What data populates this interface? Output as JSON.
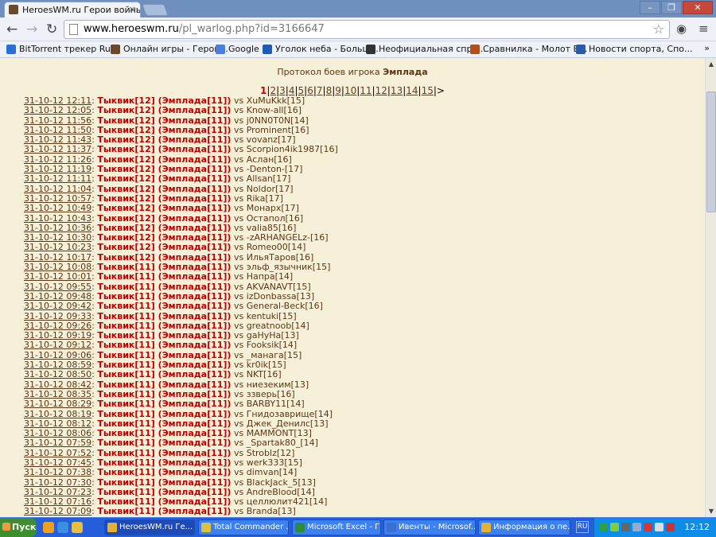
{
  "browser": {
    "tab_title": "HeroesWM.ru Герои войны и",
    "tab_close": "×",
    "window_buttons": [
      "–",
      "❐",
      "✕"
    ],
    "url_host": "www.heroeswm.ru",
    "url_path": "/pl_warlog.php?id=3166647",
    "bookmarks": [
      {
        "label": "BitTorrent трекер Ru...",
        "icon_color": "#2a6fd6"
      },
      {
        "label": "Онлайн игры - Герои...",
        "icon_color": "#6a4a2a"
      },
      {
        "label": "Google",
        "icon_color": "#4a7fe0"
      },
      {
        "label": "Уголок неба - Больш...",
        "icon_color": "#1a5fb4"
      },
      {
        "label": "Неофициальная спра...",
        "icon_color": "#333333"
      },
      {
        "label": "Сравнилка - Молот В...",
        "icon_color": "#b0501a"
      },
      {
        "label": "Новости спорта, Спо...",
        "icon_color": "#2b5aa8"
      }
    ],
    "bookmarks_more": "»"
  },
  "page": {
    "heading_prefix": "Протокол боев игрока",
    "player_name": "Эмплада",
    "pager": {
      "current": "1",
      "pages": [
        "2",
        "3",
        "4",
        "5",
        "6",
        "7",
        "8",
        "9",
        "10",
        "11",
        "12",
        "13",
        "14",
        "15"
      ],
      "next": ">"
    },
    "log": [
      {
        "date": "31-10-12 12:11",
        "team": "Тыквик[12] (Эмплада[11])",
        "opp": "XuMuKkk[15]"
      },
      {
        "date": "31-10-12 12:05",
        "team": "Тыквик[12] (Эмплада[11])",
        "opp": "Know-all[16]"
      },
      {
        "date": "31-10-12 11:56",
        "team": "Тыквик[12] (Эмплада[11])",
        "opp": "j0NN0T0N[14]"
      },
      {
        "date": "31-10-12 11:50",
        "team": "Тыквик[12] (Эмплада[11])",
        "opp": "Prominent[16]"
      },
      {
        "date": "31-10-12 11:43",
        "team": "Тыквик[12] (Эмплада[11])",
        "opp": "vovanz[17]"
      },
      {
        "date": "31-10-12 11:37",
        "team": "Тыквик[12] (Эмплада[11])",
        "opp": "Scorpion4ik1987[16]"
      },
      {
        "date": "31-10-12 11:26",
        "team": "Тыквик[12] (Эмплада[11])",
        "opp": "Аслан[16]"
      },
      {
        "date": "31-10-12 11:19",
        "team": "Тыквик[12] (Эмплада[11])",
        "opp": "-Denton-[17]"
      },
      {
        "date": "31-10-12 11:11",
        "team": "Тыквик[12] (Эмплада[11])",
        "opp": "Allsan[17]"
      },
      {
        "date": "31-10-12 11:04",
        "team": "Тыквик[12] (Эмплада[11])",
        "opp": "Noldor[17]"
      },
      {
        "date": "31-10-12 10:57",
        "team": "Тыквик[12] (Эмплада[11])",
        "opp": "Rika[17]"
      },
      {
        "date": "31-10-12 10:49",
        "team": "Тыквик[12] (Эмплада[11])",
        "opp": "Монарх[17]"
      },
      {
        "date": "31-10-12 10:43",
        "team": "Тыквик[12] (Эмплада[11])",
        "opp": "Остапол[16]"
      },
      {
        "date": "31-10-12 10:36",
        "team": "Тыквик[12] (Эмплада[11])",
        "opp": "valia85[16]"
      },
      {
        "date": "31-10-12 10:30",
        "team": "Тыквик[12] (Эмплада[11])",
        "opp": "-zARHANGELz-[16]"
      },
      {
        "date": "31-10-12 10:23",
        "team": "Тыквик[12] (Эмплада[11])",
        "opp": "Romeo00[14]"
      },
      {
        "date": "31-10-12 10:17",
        "team": "Тыквик[12] (Эмплада[11])",
        "opp": "ИльяТаров[16]"
      },
      {
        "date": "31-10-12 10:08",
        "team": "Тыквик[11] (Эмплада[11])",
        "opp": "эльф_язычник[15]"
      },
      {
        "date": "31-10-12 10:01",
        "team": "Тыквик[11] (Эмплада[11])",
        "opp": "Напра[14]"
      },
      {
        "date": "31-10-12 09:55",
        "team": "Тыквик[11] (Эмплада[11])",
        "opp": "AKVANAVT[15]"
      },
      {
        "date": "31-10-12 09:48",
        "team": "Тыквик[11] (Эмплада[11])",
        "opp": "izDonbassa[13]"
      },
      {
        "date": "31-10-12 09:42",
        "team": "Тыквик[11] (Эмплада[11])",
        "opp": "General-Beck[16]"
      },
      {
        "date": "31-10-12 09:33",
        "team": "Тыквик[11] (Эмплада[11])",
        "opp": "kentuki[15]"
      },
      {
        "date": "31-10-12 09:26",
        "team": "Тыквик[11] (Эмплада[11])",
        "opp": "greatnoob[14]"
      },
      {
        "date": "31-10-12 09:19",
        "team": "Тыквик[11] (Эмплада[11])",
        "opp": "gaHyHa[13]"
      },
      {
        "date": "31-10-12 09:12",
        "team": "Тыквик[11] (Эмплада[11])",
        "opp": "Fooksik[14]"
      },
      {
        "date": "31-10-12 09:06",
        "team": "Тыквик[11] (Эмплада[11])",
        "opp": "_манага[15]"
      },
      {
        "date": "31-10-12 08:59",
        "team": "Тыквик[11] (Эмплада[11])",
        "opp": "kr0ik[15]"
      },
      {
        "date": "31-10-12 08:50",
        "team": "Тыквик[11] (Эмплада[11])",
        "opp": "NKT[16]"
      },
      {
        "date": "31-10-12 08:42",
        "team": "Тыквик[11] (Эмплада[11])",
        "opp": "ниезеким[13]"
      },
      {
        "date": "31-10-12 08:35",
        "team": "Тыквик[11] (Эмплада[11])",
        "opp": "ззверь[16]"
      },
      {
        "date": "31-10-12 08:29",
        "team": "Тыквик[11] (Эмплада[11])",
        "opp": "BARBY11[14]"
      },
      {
        "date": "31-10-12 08:19",
        "team": "Тыквик[11] (Эмплада[11])",
        "opp": "Гнидозаврище[14]"
      },
      {
        "date": "31-10-12 08:12",
        "team": "Тыквик[11] (Эмплада[11])",
        "opp": "Джек_Денилс[13]"
      },
      {
        "date": "31-10-12 08:06",
        "team": "Тыквик[11] (Эмплада[11])",
        "opp": "MAMMONT[13]"
      },
      {
        "date": "31-10-12 07:59",
        "team": "Тыквик[11] (Эмплада[11])",
        "opp": "_Spartak80_[14]"
      },
      {
        "date": "31-10-12 07:52",
        "team": "Тыквик[11] (Эмплада[11])",
        "opp": "Stroblz[12]"
      },
      {
        "date": "31-10-12 07:45",
        "team": "Тыквик[11] (Эмплада[11])",
        "opp": "werk333[15]"
      },
      {
        "date": "31-10-12 07:38",
        "team": "Тыквик[11] (Эмплада[11])",
        "opp": "dimvan[14]"
      },
      {
        "date": "31-10-12 07:30",
        "team": "Тыквик[11] (Эмплада[11])",
        "opp": "BlackJack_5[13]"
      },
      {
        "date": "31-10-12 07:23",
        "team": "Тыквик[11] (Эмплада[11])",
        "opp": "AndreBlood[14]"
      },
      {
        "date": "31-10-12 07:16",
        "team": "Тыквик[11] (Эмплада[11])",
        "opp": "целлюлит421[14]"
      },
      {
        "date": "31-10-12 07:09",
        "team": "Тыквик[11] (Эмплада[11])",
        "opp": "Branda[13]"
      }
    ],
    "vs_text": "vs"
  },
  "taskbar": {
    "start_label": "Пуск",
    "tasks": [
      {
        "label": "HeroesWM.ru Ге...",
        "icon_color": "#e8b030",
        "active": true
      },
      {
        "label": "Total Commander ...",
        "icon_color": "#e0c040",
        "active": false
      },
      {
        "label": "Microsoft Excel - Г...",
        "icon_color": "#2e8b3a",
        "active": false
      },
      {
        "label": "Ивенты - Microsof...",
        "icon_color": "#3a6fd0",
        "active": false
      },
      {
        "label": "Информация о пе...",
        "icon_color": "#e8b030",
        "active": false
      }
    ],
    "lang": "RU",
    "clock": "12:12"
  }
}
